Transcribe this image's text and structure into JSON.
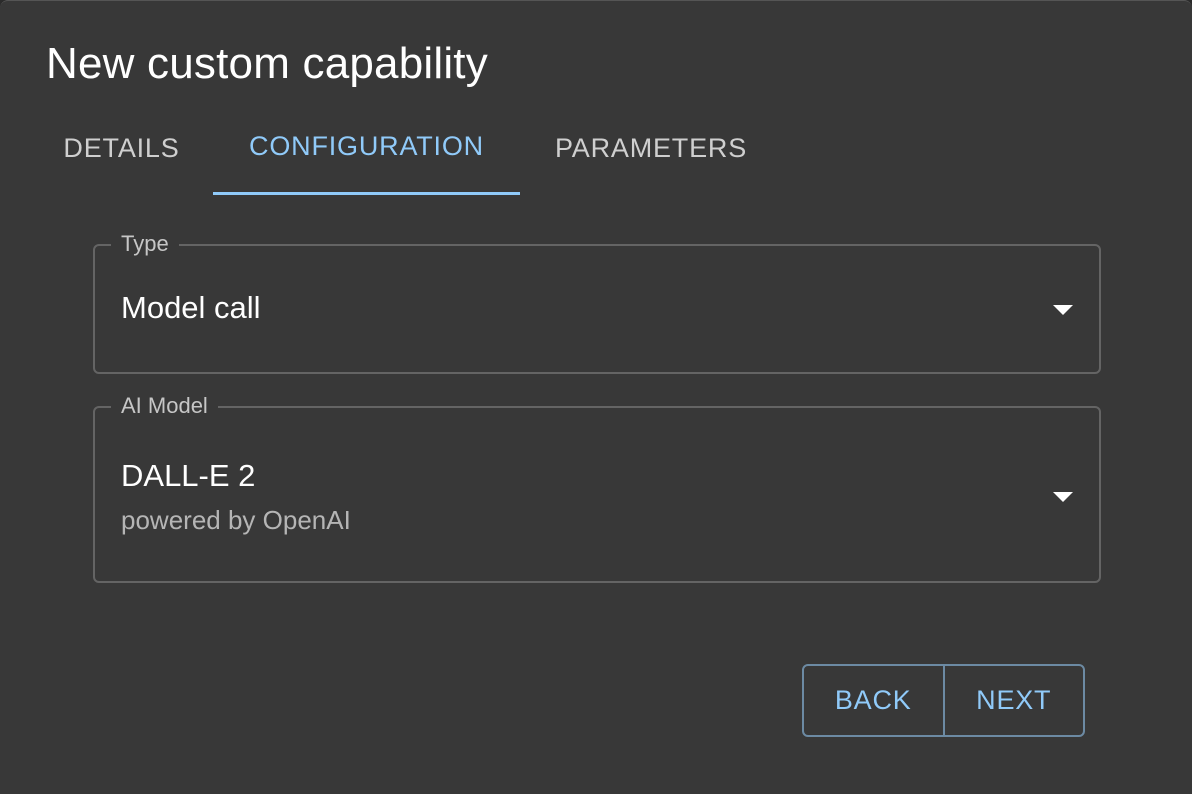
{
  "dialog": {
    "title": "New custom capability"
  },
  "tabs": [
    {
      "label": "DETAILS",
      "active": false
    },
    {
      "label": "CONFIGURATION",
      "active": true
    },
    {
      "label": "PARAMETERS",
      "active": false
    }
  ],
  "fields": {
    "type": {
      "label": "Type",
      "value": "Model call"
    },
    "ai_model": {
      "label": "AI Model",
      "value": "DALL-E 2",
      "secondary": "powered by OpenAI"
    }
  },
  "actions": {
    "back_label": "BACK",
    "next_label": "NEXT"
  },
  "colors": {
    "background": "#383838",
    "accent": "#90caf9",
    "text": "#ffffff",
    "border": "#646464"
  },
  "icons": {
    "dropdown": "chevron-down-icon"
  }
}
